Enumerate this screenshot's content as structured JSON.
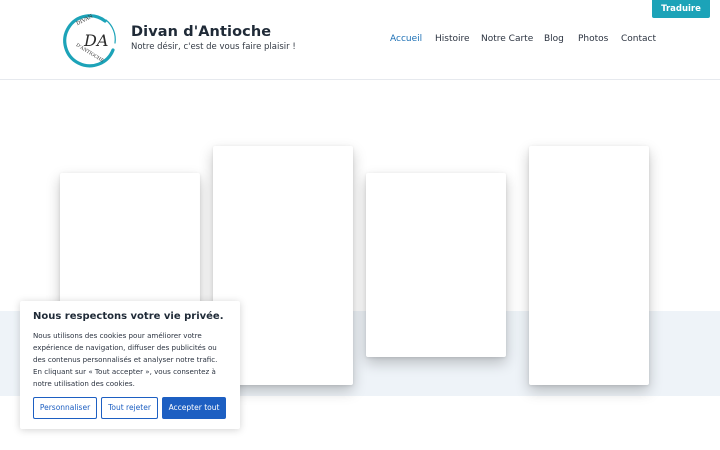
{
  "header": {
    "logo": {
      "text_top": "DIVAN",
      "monogram": "DA",
      "text_bottom": "D'ANTIOCHE",
      "ring_color": "#1ca3b8"
    },
    "title": "Divan d'Antioche",
    "tagline": "Notre désir, c'est de vous faire plaisir !",
    "translate_label": "Traduire",
    "translate_color": "#1ca3b8"
  },
  "nav": {
    "items": [
      {
        "label": "Accueil",
        "active": true
      },
      {
        "label": "Histoire",
        "active": false
      },
      {
        "label": "Notre Carte",
        "active": false
      },
      {
        "label": "Blog",
        "active": false
      },
      {
        "label": "Photos",
        "active": false
      },
      {
        "label": "Contact",
        "active": false
      }
    ],
    "active_color": "#1b6fb5"
  },
  "cookie": {
    "title": "Nous respectons votre vie privée.",
    "text": "Nous utilisons des cookies pour améliorer votre expérience de navigation, diffuser des publicités ou des contenus personnalisés et analyser notre trafic. En cliquant sur « Tout accepter », vous consentez à notre utilisation des cookies.",
    "customize_label": "Personnaliser",
    "reject_label": "Tout rejeter",
    "accept_label": "Accepter tout",
    "accent_color": "#1d5fc2"
  }
}
